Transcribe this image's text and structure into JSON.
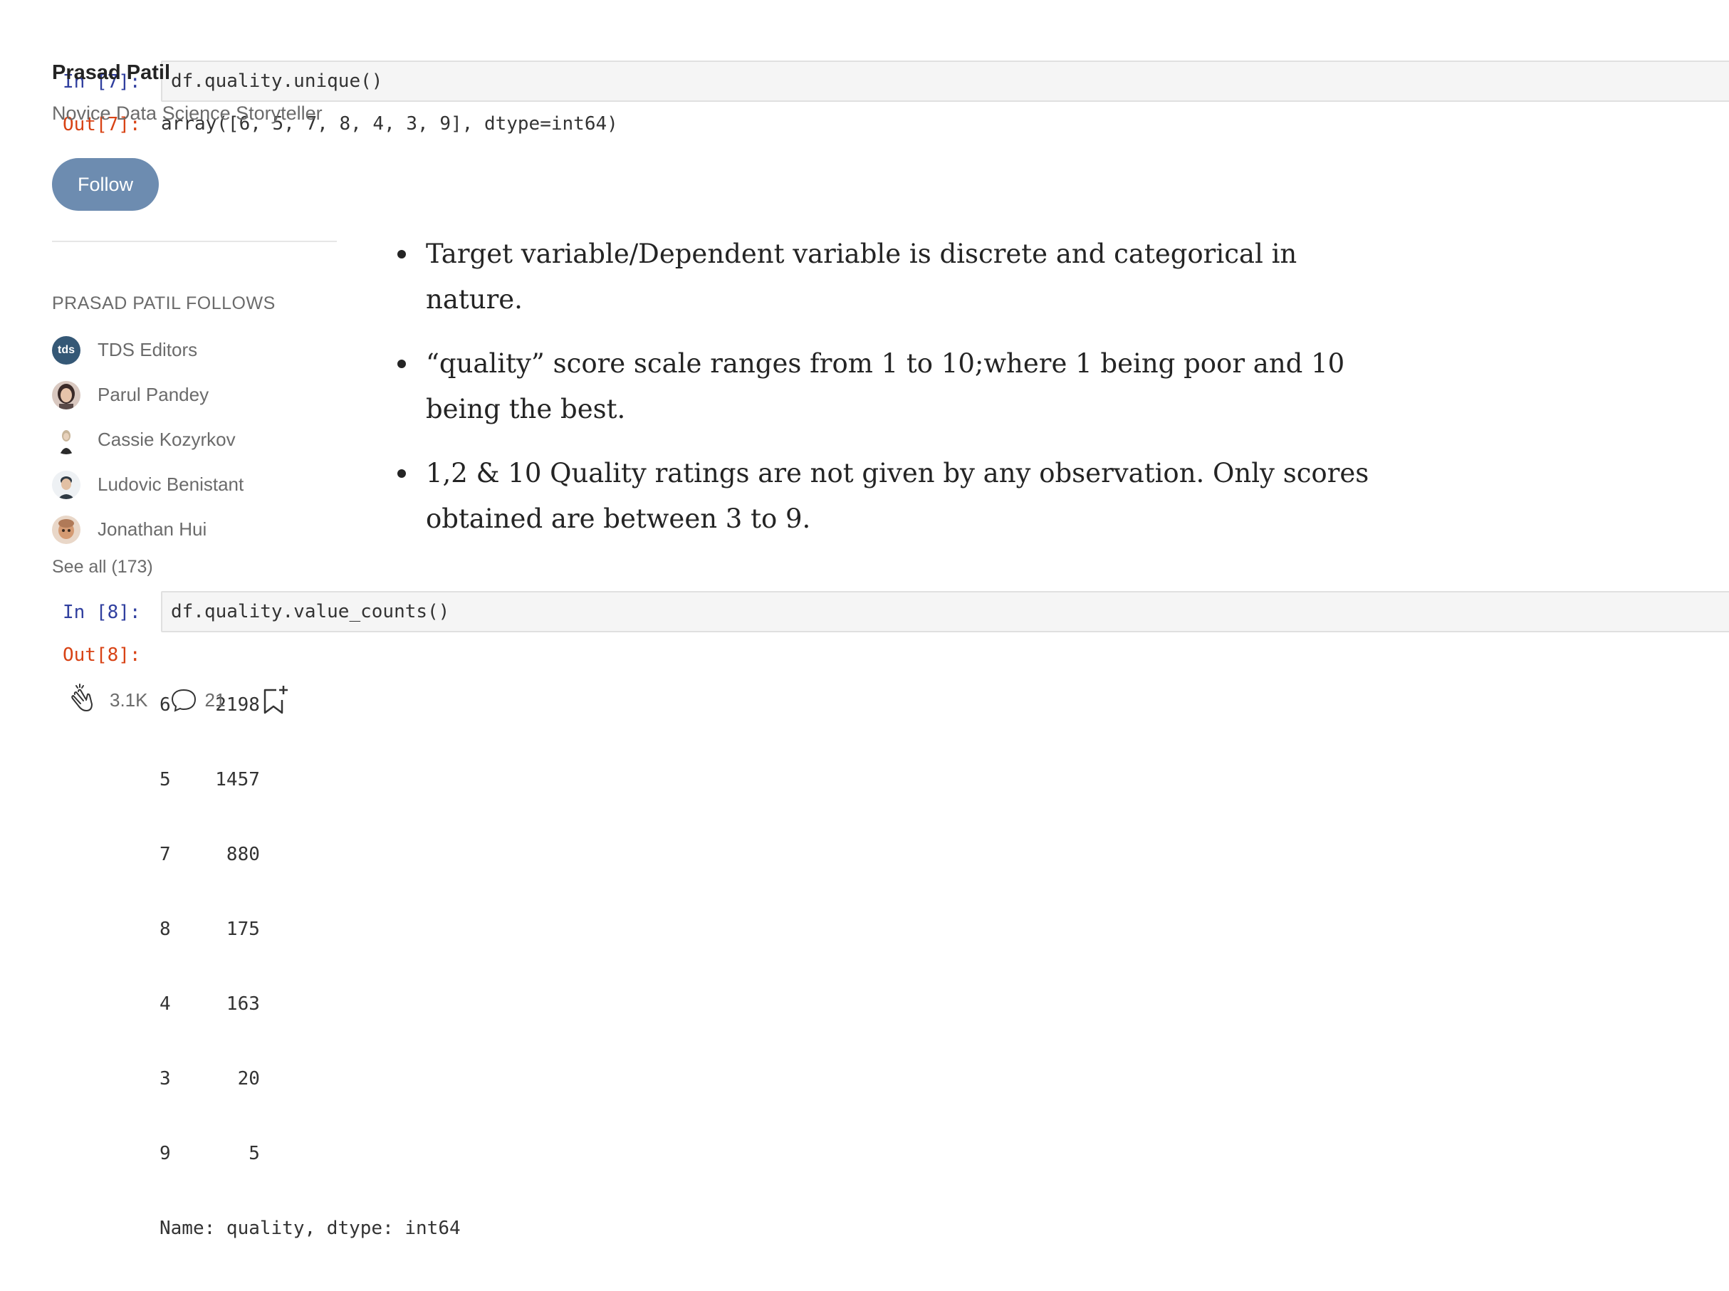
{
  "cells": [
    {
      "in_prompt": "In [7]:",
      "code": "df.quality.unique()",
      "out_prompt": "Out[7]:",
      "output": "array([6, 5, 7, 8, 4, 3, 9], dtype=int64)"
    },
    {
      "in_prompt": "In [8]:",
      "code": "df.quality.value_counts()",
      "out_prompt": "Out[8]:",
      "output_rows": [
        "6    2198",
        "5    1457",
        "7     880",
        "8     175",
        "4     163",
        "3      20",
        "9       5"
      ],
      "output_footer": "Name: quality, dtype: int64"
    }
  ],
  "bullets": [
    "Target variable/Dependent variable is discrete and categorical in nature.",
    "“quality” score scale ranges from 1 to 10;where 1 being poor and 10 being the best.",
    "1,2 & 10 Quality ratings are not given by any observation. Only scores obtained are between 3 to 9."
  ],
  "sidebar": {
    "author_name": "Prasad Patil",
    "author_bio": "Novice Data Science Storyteller",
    "follow_label": "Follow",
    "follows_heading": "PRASAD PATIL FOLLOWS",
    "follows": [
      {
        "name": "TDS Editors",
        "avatar_text": "tds",
        "avatar_color": "#355876"
      },
      {
        "name": "Parul Pandey",
        "avatar_color": "#3a2a28"
      },
      {
        "name": "Cassie Kozyrkov",
        "avatar_color": "#c8b59a"
      },
      {
        "name": "Ludovic Benistant",
        "avatar_color": "#2f3a44"
      },
      {
        "name": "Jonathan Hui",
        "avatar_color": "#b07a58"
      }
    ],
    "see_all": "See all (173)",
    "claps": "3.1K",
    "responses": "21"
  },
  "colors": {
    "accent": "#6d8cb0",
    "in_prompt": "#303f9f",
    "out_prompt": "#d84315"
  }
}
